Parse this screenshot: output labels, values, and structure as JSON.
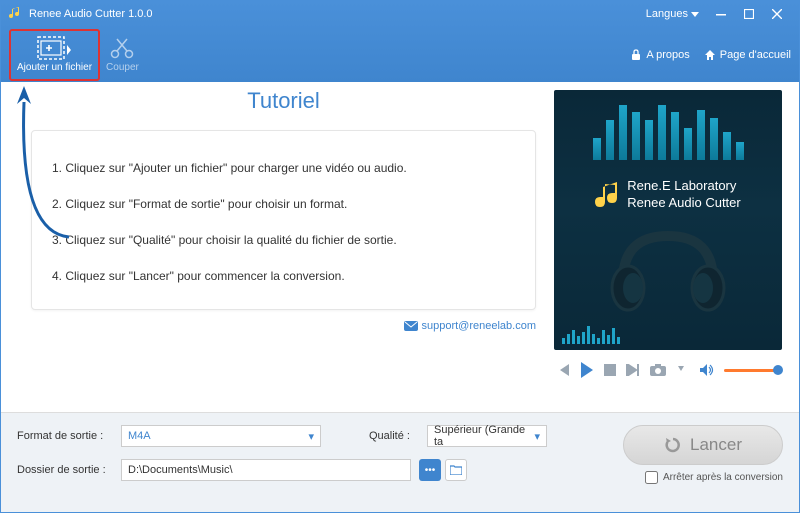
{
  "app": {
    "title": "Renee Audio Cutter 1.0.0"
  },
  "header": {
    "langues": "Langues",
    "add_file": "Ajouter un fichier",
    "cut": "Couper",
    "about": "A propos",
    "home": "Page d'accueil"
  },
  "tutorial": {
    "title": "Tutoriel",
    "steps": [
      "1. Cliquez sur \"Ajouter un fichier\" pour charger une vidéo ou audio.",
      "2. Cliquez sur \"Format de sortie\" pour choisir un format.",
      "3. Cliquez sur \"Qualité\" pour choisir la qualité du fichier de sortie.",
      "4. Cliquez sur \"Lancer\" pour commencer la conversion."
    ],
    "support": "support@reneelab.com"
  },
  "preview": {
    "brand1": "Rene.E Laboratory",
    "brand2": "Renee Audio Cutter"
  },
  "settings": {
    "format_label": "Format de sortie :",
    "format_value": "M4A",
    "quality_label": "Qualité :",
    "quality_value": "Supérieur (Grande ta",
    "folder_label": "Dossier de sortie :",
    "folder_value": "D:\\Documents\\Music\\"
  },
  "launch": {
    "label": "Lancer",
    "stop_after": "Arrêter après la conversion"
  }
}
